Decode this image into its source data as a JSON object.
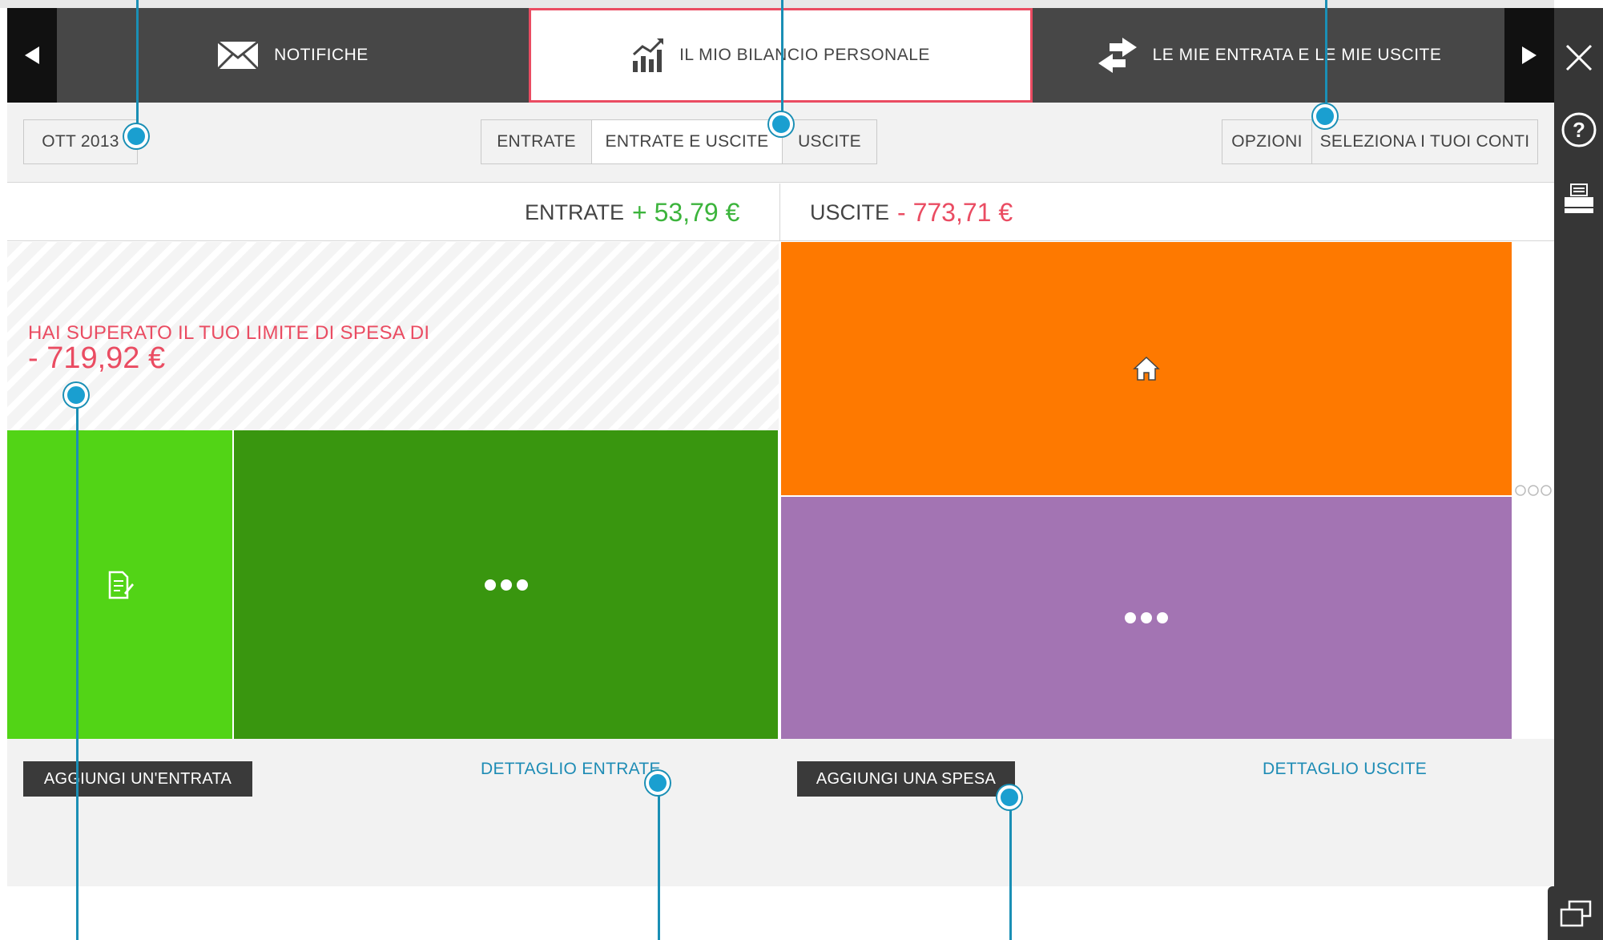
{
  "tabs": {
    "prev_label": "",
    "next_label": "",
    "items": [
      {
        "label": "NOTIFICHE",
        "icon": "envelope-icon",
        "active": false
      },
      {
        "label": "IL MIO BILANCIO PERSONALE",
        "icon": "chart-growth-icon",
        "active": true
      },
      {
        "label": "LE MIE ENTRATA E LE MIE USCITE",
        "icon": "swap-arrows-icon",
        "active": false
      }
    ]
  },
  "toolbar": {
    "period": "OTT 2013",
    "filters": [
      "ENTRATE",
      "ENTRATE E USCITE",
      "USCITE"
    ],
    "selected_filter": "ENTRATE E USCITE",
    "options_label": "OPZIONI",
    "accounts_label": "SELEZIONA I TUOI CONTI"
  },
  "totals": {
    "income_label": "ENTRATE",
    "income_amount": "+ 53,79 €",
    "expense_label": "USCITE",
    "expense_amount": "- 773,71 €"
  },
  "income_panel": {
    "limit_message": "HAI SUPERATO IL TUO LIMITE DI SPESA DI",
    "limit_amount": "- 719,92 €",
    "blocks": [
      {
        "icon": "document-edit-icon",
        "color": "#52d416"
      },
      {
        "icon": "more-dots-icon",
        "color": "#39960f"
      }
    ]
  },
  "expense_panel": {
    "blocks": [
      {
        "icon": "home-icon",
        "color": "#fe7900"
      },
      {
        "icon": "more-dots-icon",
        "color": "#a374b3"
      }
    ]
  },
  "actions": {
    "add_income": "AGGIUNGI UN'ENTRATA",
    "income_detail": "DETTAGLIO ENTRATE",
    "add_expense": "AGGIUNGI UNA SPESA",
    "expense_detail": "DETTAGLIO USCITE"
  },
  "sidebar": {
    "icons": [
      "close-icon",
      "help-icon",
      "print-icon"
    ]
  },
  "colors": {
    "accent_red": "#ea4c62",
    "income_green": "#3cb43c",
    "callout_blue": "#1a8fb5",
    "link_blue": "#1e8cb5"
  }
}
